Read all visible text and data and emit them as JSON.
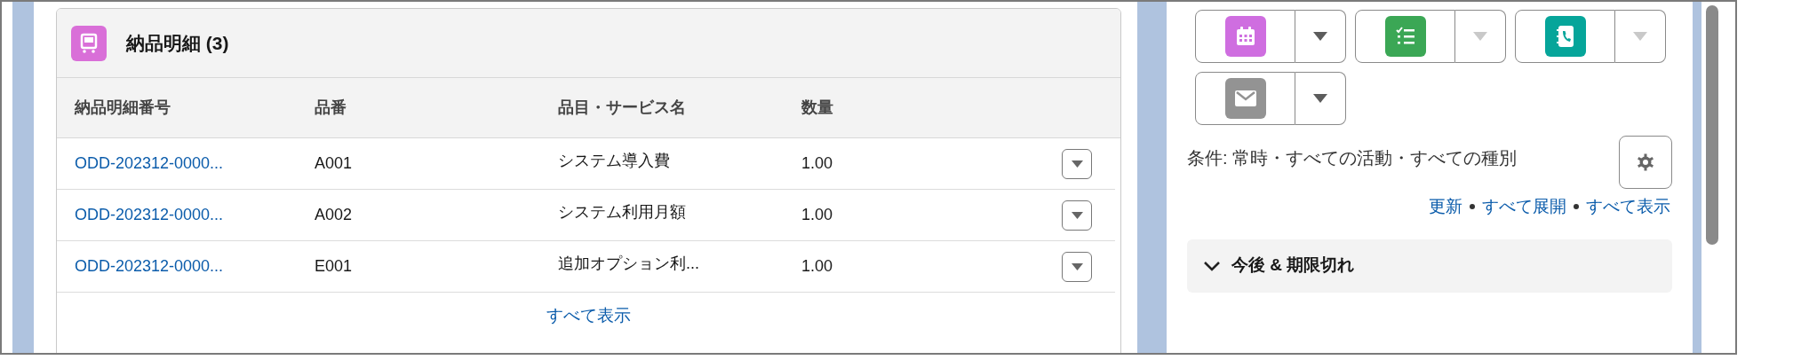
{
  "card": {
    "title": "納品明細 (3)",
    "columns": [
      "納品明細番号",
      "品番",
      "品目・サービス名",
      "数量"
    ],
    "rows": [
      {
        "number": "ODD-202312-0000...",
        "code": "A001",
        "name": "システム導入費",
        "quantity": "1.00"
      },
      {
        "number": "ODD-202312-0000...",
        "code": "A002",
        "name": "システム利用月額",
        "quantity": "1.00"
      },
      {
        "number": "ODD-202312-0000...",
        "code": "E001",
        "name": "追加オプション利...",
        "quantity": "1.00"
      }
    ],
    "footer_link": "すべて表示"
  },
  "activity": {
    "actions": [
      {
        "kind": "event",
        "color": "#cf6ee0",
        "menu_disabled": false
      },
      {
        "kind": "task",
        "color": "#3ba755",
        "menu_disabled": true
      },
      {
        "kind": "call",
        "color": "#06a59a",
        "menu_disabled": true
      },
      {
        "kind": "email",
        "color": "#939393",
        "menu_disabled": false
      }
    ],
    "filter_text": "条件: 常時・すべての活動・すべての種別",
    "links": [
      "更新",
      "すべて展開",
      "すべて表示"
    ],
    "section": {
      "title": "今後 & 期限切れ",
      "expanded": true
    }
  }
}
